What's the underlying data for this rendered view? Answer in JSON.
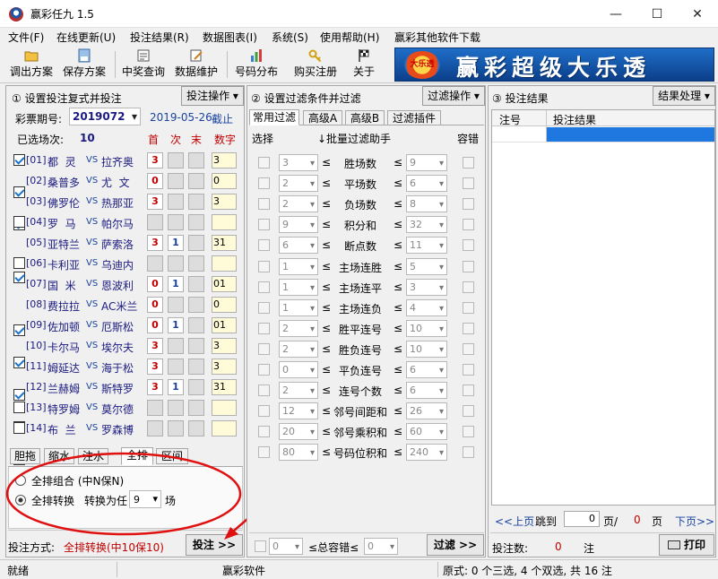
{
  "app": {
    "title": "赢彩任九 1.5"
  },
  "menu": [
    "文件(F)",
    "在线更新(U)",
    "投注结果(R)",
    "数据图表(I)",
    "系统(S)",
    "使用帮助(H)",
    "赢彩其他软件下载"
  ],
  "toolbar": [
    "调出方案",
    "保存方案",
    "中奖查询",
    "数据维护",
    "号码分布",
    "购买注册",
    "关于"
  ],
  "banner": {
    "logo": "大乐透",
    "text": "赢彩超级大乐透"
  },
  "panel1": {
    "title": "① 设置投注复式并投注",
    "op_button": "投注操作",
    "period_label": "彩票期号:",
    "period": "2019072",
    "date": "2019-05-26",
    "deadline": "截止",
    "selected_label": "已选场次:",
    "selected": "10",
    "col_first": "首",
    "col_second": "次",
    "col_last": "末",
    "col_digits": "数字"
  },
  "matches": [
    {
      "no": "[01]",
      "home": "都  灵",
      "vs": "VS",
      "away": "拉齐奥",
      "checked": true,
      "first": "3",
      "second": "",
      "last": "",
      "digits": "3"
    },
    {
      "no": "[02]",
      "home": "桑普多",
      "vs": "VS",
      "away": "尤  文",
      "checked": true,
      "first": "0",
      "second": "",
      "last": "",
      "digits": "0"
    },
    {
      "no": "[03]",
      "home": "佛罗伦",
      "vs": "VS",
      "away": "热那亚",
      "checked": true,
      "first": "3",
      "second": "",
      "last": "",
      "digits": "3"
    },
    {
      "no": "[04]",
      "home": "罗  马",
      "vs": "VS",
      "away": "帕尔马",
      "checked": false,
      "first": "",
      "second": "",
      "last": "",
      "digits": ""
    },
    {
      "no": "[05]",
      "home": "亚特兰",
      "vs": "VS",
      "away": "萨索洛",
      "checked": true,
      "first": "3",
      "second": "1",
      "last": "",
      "digits": "31"
    },
    {
      "no": "[06]",
      "home": "卡利亚",
      "vs": "VS",
      "away": "乌迪内",
      "checked": false,
      "first": "",
      "second": "",
      "last": "",
      "digits": ""
    },
    {
      "no": "[07]",
      "home": "国  米",
      "vs": "VS",
      "away": "恩波利",
      "checked": true,
      "first": "0",
      "second": "1",
      "last": "",
      "digits": "01"
    },
    {
      "no": "[08]",
      "home": "费拉拉",
      "vs": "VS",
      "away": "AC米兰",
      "checked": true,
      "first": "0",
      "second": "",
      "last": "",
      "digits": "0"
    },
    {
      "no": "[09]",
      "home": "佐加顿",
      "vs": "VS",
      "away": "厄斯松",
      "checked": true,
      "first": "0",
      "second": "1",
      "last": "",
      "digits": "01"
    },
    {
      "no": "[10]",
      "home": "卡尔马",
      "vs": "VS",
      "away": "埃尔夫",
      "checked": true,
      "first": "3",
      "second": "",
      "last": "",
      "digits": "3"
    },
    {
      "no": "[11]",
      "home": "姆延达",
      "vs": "VS",
      "away": "海于松",
      "checked": true,
      "first": "3",
      "second": "",
      "last": "",
      "digits": "3"
    },
    {
      "no": "[12]",
      "home": "兰赫姆",
      "vs": "VS",
      "away": "斯特罗",
      "checked": true,
      "first": "3",
      "second": "1",
      "last": "",
      "digits": "31"
    },
    {
      "no": "[13]",
      "home": "特罗姆",
      "vs": "VS",
      "away": "莫尔德",
      "checked": false,
      "first": "",
      "second": "",
      "last": "",
      "digits": ""
    },
    {
      "no": "[14]",
      "home": "布  兰",
      "vs": "VS",
      "away": "罗森博",
      "checked": false,
      "first": "",
      "second": "",
      "last": "",
      "digits": ""
    }
  ],
  "bet_tabs": [
    "胆拖",
    "缩水",
    "注水",
    "全排",
    "区间"
  ],
  "bet_options": {
    "opt1": "全排组合  (中N保N)",
    "opt2": "全排转换",
    "convert_label": "转换为任",
    "convert_value": "9",
    "convert_unit": "场"
  },
  "bet_footer": {
    "label": "投注方式:",
    "mode": "全排转换(中10保10)",
    "button": "投注 >>"
  },
  "panel2": {
    "title": "② 设置过滤条件并过滤",
    "op_button": "过滤操作",
    "tabs": [
      "常用过滤",
      "高级A",
      "高级B",
      "过滤插件"
    ],
    "col_select": "选择",
    "col_helper": "↓批量过滤助手",
    "col_tolerance": "容错"
  },
  "filters": [
    {
      "name": "胜场数",
      "lo": "3",
      "hi": "9"
    },
    {
      "name": "平场数",
      "lo": "2",
      "hi": "6"
    },
    {
      "name": "负场数",
      "lo": "2",
      "hi": "8"
    },
    {
      "name": "积分和",
      "lo": "9",
      "hi": "32"
    },
    {
      "name": "断点数",
      "lo": "6",
      "hi": "11"
    },
    {
      "name": "主场连胜",
      "lo": "1",
      "hi": "5"
    },
    {
      "name": "主场连平",
      "lo": "1",
      "hi": "3"
    },
    {
      "name": "主场连负",
      "lo": "1",
      "hi": "4"
    },
    {
      "name": "胜平连号",
      "lo": "2",
      "hi": "10"
    },
    {
      "name": "胜负连号",
      "lo": "2",
      "hi": "10"
    },
    {
      "name": "平负连号",
      "lo": "0",
      "hi": "6"
    },
    {
      "name": "连号个数",
      "lo": "2",
      "hi": "6"
    },
    {
      "name": "邻号间距和",
      "lo": "12",
      "hi": "26"
    },
    {
      "name": "邻号乘积和",
      "lo": "20",
      "hi": "60"
    },
    {
      "name": "号码位积和",
      "lo": "80",
      "hi": "240"
    }
  ],
  "filter_footer": {
    "lo": "0",
    "label": "总容错",
    "hi": "0",
    "button": "过滤 >>"
  },
  "panel3": {
    "title": "③ 投注结果",
    "op_button": "结果处理",
    "col_no": "注号",
    "col_result": "投注结果",
    "prev": "<<上页",
    "jump": "跳到",
    "page_value": "0",
    "page_sep": "页/",
    "page_total": "0",
    "page_unit": "页",
    "next": "下页>>",
    "count_label": "投注数:",
    "count": "0",
    "count_unit": "注",
    "print": "打印"
  },
  "status": {
    "left": "就绪",
    "center": "赢彩软件",
    "right": "原式: 0 个三选, 4 个双选, 共 16 注"
  }
}
